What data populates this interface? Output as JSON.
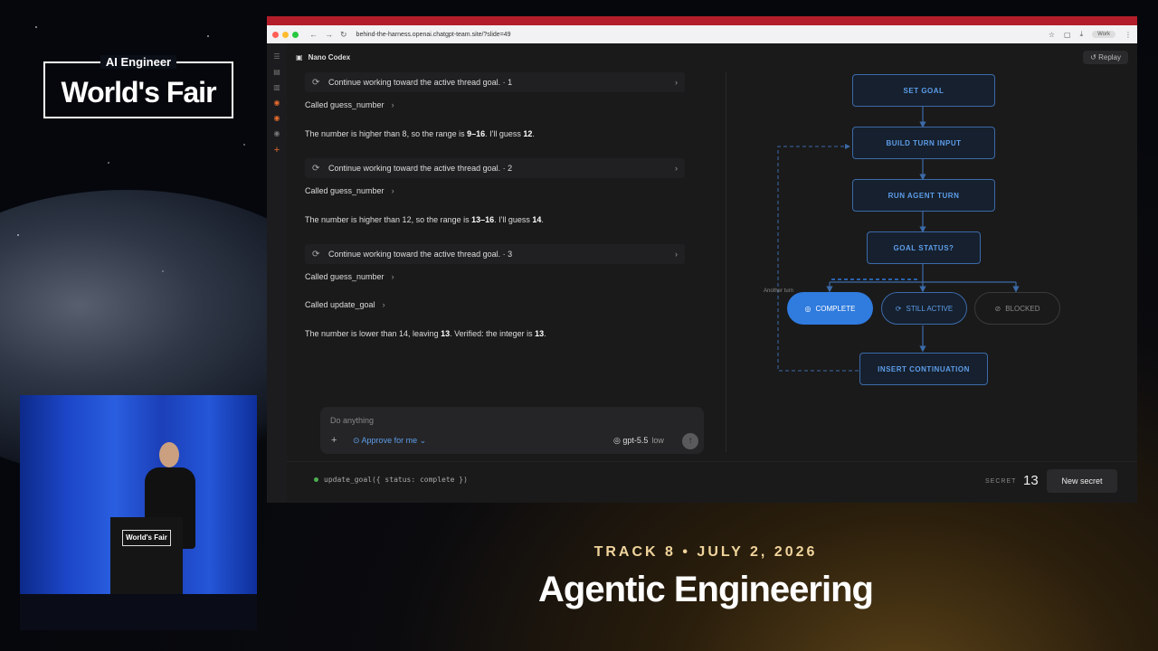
{
  "conference": {
    "logo_top": "AI Engineer",
    "logo_main": "World's Fair",
    "podium_label": "World's Fair",
    "track_line": "TRACK 8 • JULY 2, 2026",
    "title": "Agentic Engineering"
  },
  "browser": {
    "url": "behind-the-harness.openai.chatgpt-team.site/?slide=49",
    "profile": "Work"
  },
  "app": {
    "name": "Nano Codex",
    "replay_label": "Replay"
  },
  "transcript": [
    {
      "kind": "thread",
      "text": "Continue working toward the active thread goal. · 1"
    },
    {
      "kind": "called",
      "text": "Called guess_number"
    },
    {
      "kind": "text",
      "pre": "The number is higher than 8, so the range is ",
      "b1": "9–16",
      "mid": ". I'll guess ",
      "b2": "12",
      "post": "."
    },
    {
      "kind": "thread",
      "text": "Continue working toward the active thread goal. · 2"
    },
    {
      "kind": "called",
      "text": "Called guess_number"
    },
    {
      "kind": "text",
      "pre": "The number is higher than 12, so the range is ",
      "b1": "13–16",
      "mid": ". I'll guess ",
      "b2": "14",
      "post": "."
    },
    {
      "kind": "thread",
      "text": "Continue working toward the active thread goal. · 3"
    },
    {
      "kind": "called",
      "text": "Called guess_number"
    },
    {
      "kind": "called",
      "text": "Called update_goal"
    },
    {
      "kind": "text",
      "pre": "The number is lower than 14, leaving ",
      "b1": "13",
      "mid": ". Verified: the integer is ",
      "b2": "13",
      "post": "."
    }
  ],
  "composer": {
    "placeholder": "Do anything",
    "approve_label": "Approve for me",
    "model": "gpt-5.5",
    "level": "low"
  },
  "diagram": {
    "set_goal": "SET GOAL",
    "build_turn": "BUILD TURN INPUT",
    "run_agent": "RUN AGENT TURN",
    "goal_status": "GOAL STATUS?",
    "complete": "COMPLETE",
    "still_active": "STILL ACTIVE",
    "blocked": "BLOCKED",
    "insert_continuation": "INSERT CONTINUATION",
    "another_turn": "Another turn",
    "accent": "#2f7bde"
  },
  "footer": {
    "command": "update_goal({ status: complete })",
    "secret_label": "SECRET",
    "secret_value": "13",
    "new_secret_label": "New secret"
  }
}
